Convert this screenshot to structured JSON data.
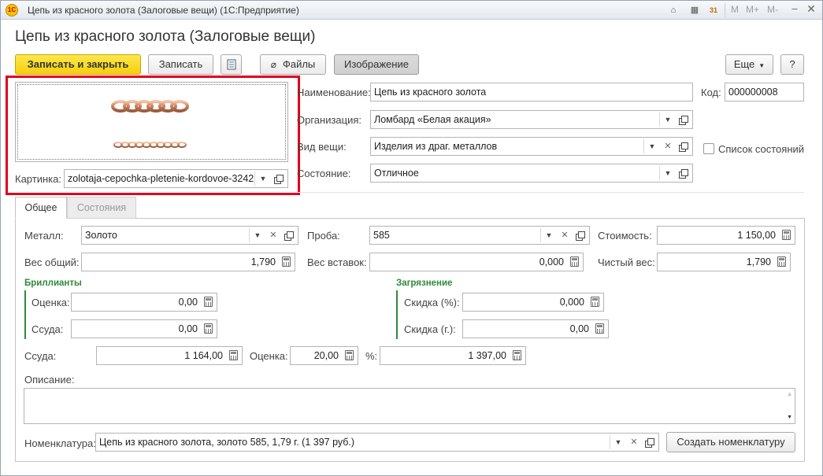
{
  "window": {
    "logo_text": "1С",
    "title": "Цепь из красного золота (Залоговые вещи)  (1С:Предприятие)",
    "calendar_day": "31",
    "memory_buttons": [
      "M",
      "M+",
      "M-"
    ],
    "minimize": "–",
    "close": "✕"
  },
  "form": {
    "title": "Цепь из красного золота (Залоговые вещи)"
  },
  "toolbar": {
    "save_close_label": "Записать и закрыть",
    "save_label": "Записать",
    "files_label": "Файлы",
    "image_label": "Изображение",
    "more_label": "Еще",
    "help_label": "?"
  },
  "picture": {
    "label": "Картинка:",
    "value": "zolotaja-cepochka-pletenie-kordovoe-3242"
  },
  "header": {
    "name_label": "Наименование:",
    "name_value": "Цепь из красного золота",
    "code_label": "Код:",
    "code_value": "000000008",
    "org_label": "Организация:",
    "org_value": "Ломбард «Белая акация»",
    "kind_label": "Вид вещи:",
    "kind_value": "Изделия из драг. металлов",
    "state_label": "Состояние:",
    "state_value": "Отличное",
    "states_list_label": "Список состояний"
  },
  "tabs": [
    {
      "label": "Общее",
      "active": true
    },
    {
      "label": "Состояния",
      "active": false
    }
  ],
  "general": {
    "metal_label": "Металл:",
    "metal_value": "Золото",
    "assay_label": "Проба:",
    "assay_value": "585",
    "cost_label": "Стоимость:",
    "cost_value": "1 150,00",
    "weight_total_label": "Вес общий:",
    "weight_total_value": "1,790",
    "weight_inserts_label": "Вес вставок:",
    "weight_inserts_value": "0,000",
    "net_weight_label": "Чистый вес:",
    "net_weight_value": "1,790",
    "diamonds": {
      "title": "Бриллианты",
      "estimate_label": "Оценка:",
      "estimate_value": "0,00",
      "loan_label": "Ссуда:",
      "loan_value": "0,00"
    },
    "pollution": {
      "title": "Загрязнение",
      "discount_pct_label": "Скидка (%):",
      "discount_pct_value": "0,000",
      "discount_g_label": "Скидка (г.):",
      "discount_g_value": "0,00"
    },
    "loan_label": "Ссуда:",
    "loan_value": "1 164,00",
    "estimate_label": "Оценка:",
    "estimate_value": "20,00",
    "pct_label": "%:",
    "pct_value": "1 397,00",
    "description_label": "Описание:",
    "description_value": "",
    "nomenclature_label": "Номенклатура:",
    "nomenclature_value": "Цепь из красного золота, золото 585, 1,79 г. (1 397 руб.)",
    "create_nomenclature_label": "Создать номенклатуру"
  },
  "colors": {
    "primary_button": "#f4cf0c",
    "highlight_border": "#e0001b",
    "group_title": "#2f8a3a"
  }
}
